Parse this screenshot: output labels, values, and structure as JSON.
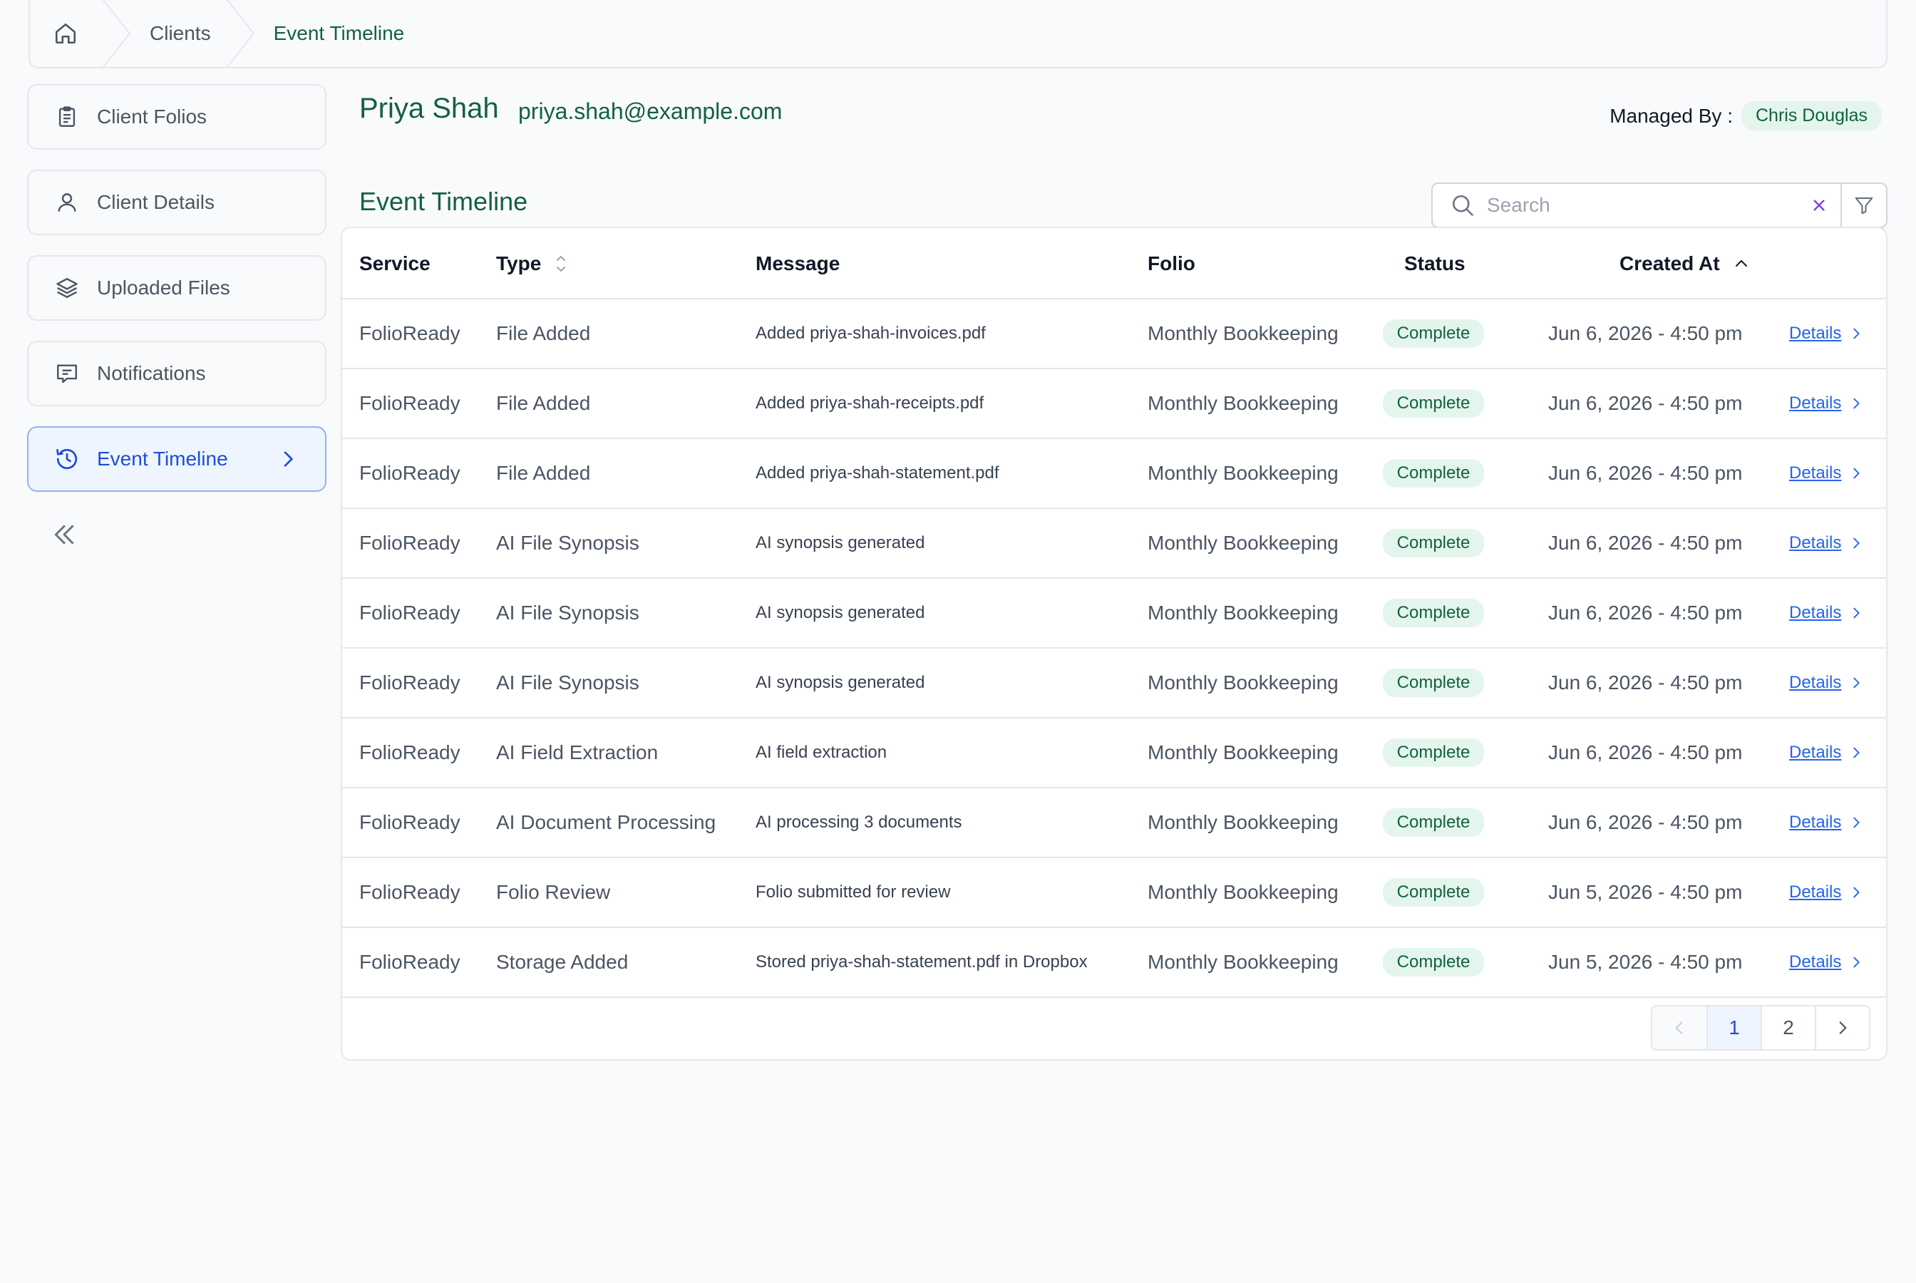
{
  "breadcrumb": {
    "items": [
      "Clients",
      "Event Timeline"
    ]
  },
  "sidebar": {
    "items": [
      {
        "label": "Client Folios"
      },
      {
        "label": "Client Details"
      },
      {
        "label": "Uploaded Files"
      },
      {
        "label": "Notifications"
      },
      {
        "label": "Event Timeline"
      }
    ]
  },
  "client": {
    "name": "Priya Shah",
    "email": "priya.shah@example.com",
    "managed_by_label": "Managed By :",
    "managed_by": "Chris Douglas"
  },
  "section_title": "Event Timeline",
  "search": {
    "placeholder": "Search",
    "value": ""
  },
  "table": {
    "columns": [
      "Service",
      "Type",
      "Message",
      "Folio",
      "Status",
      "Created At"
    ],
    "rows": [
      {
        "service": "FolioReady",
        "type": "File Added",
        "message": "Added priya-shah-invoices.pdf",
        "folio": "Monthly Bookkeeping",
        "status": "Complete",
        "created": "Jun 6, 2026 - 4:50 pm",
        "action": "Details"
      },
      {
        "service": "FolioReady",
        "type": "File Added",
        "message": "Added priya-shah-receipts.pdf",
        "folio": "Monthly Bookkeeping",
        "status": "Complete",
        "created": "Jun 6, 2026 - 4:50 pm",
        "action": "Details"
      },
      {
        "service": "FolioReady",
        "type": "File Added",
        "message": "Added priya-shah-statement.pdf",
        "folio": "Monthly Bookkeeping",
        "status": "Complete",
        "created": "Jun 6, 2026 - 4:50 pm",
        "action": "Details"
      },
      {
        "service": "FolioReady",
        "type": "AI File Synopsis",
        "message": "AI synopsis generated",
        "folio": "Monthly Bookkeeping",
        "status": "Complete",
        "created": "Jun 6, 2026 - 4:50 pm",
        "action": "Details"
      },
      {
        "service": "FolioReady",
        "type": "AI File Synopsis",
        "message": "AI synopsis generated",
        "folio": "Monthly Bookkeeping",
        "status": "Complete",
        "created": "Jun 6, 2026 - 4:50 pm",
        "action": "Details"
      },
      {
        "service": "FolioReady",
        "type": "AI File Synopsis",
        "message": "AI synopsis generated",
        "folio": "Monthly Bookkeeping",
        "status": "Complete",
        "created": "Jun 6, 2026 - 4:50 pm",
        "action": "Details"
      },
      {
        "service": "FolioReady",
        "type": "AI Field Extraction",
        "message": "AI field extraction",
        "folio": "Monthly Bookkeeping",
        "status": "Complete",
        "created": "Jun 6, 2026 - 4:50 pm",
        "action": "Details"
      },
      {
        "service": "FolioReady",
        "type": "AI Document Processing",
        "message": "AI processing 3 documents",
        "folio": "Monthly Bookkeeping",
        "status": "Complete",
        "created": "Jun 6, 2026 - 4:50 pm",
        "action": "Details"
      },
      {
        "service": "FolioReady",
        "type": "Folio Review",
        "message": "Folio submitted for review",
        "folio": "Monthly Bookkeeping",
        "status": "Complete",
        "created": "Jun 5, 2026 - 4:50 pm",
        "action": "Details"
      },
      {
        "service": "FolioReady",
        "type": "Storage Added",
        "message": "Stored priya-shah-statement.pdf in Dropbox",
        "folio": "Monthly Bookkeeping",
        "status": "Complete",
        "created": "Jun 5, 2026 - 4:50 pm",
        "action": "Details"
      }
    ]
  },
  "pagination": {
    "pages": [
      "1",
      "2"
    ],
    "current": "1"
  },
  "colors": {
    "brand_green": "#136140",
    "badge_bg": "#e3f5ec",
    "link_blue": "#2563eb",
    "active_bg": "#eff5ff"
  },
  "icons": [
    "home-icon",
    "clipboard-icon",
    "user-icon",
    "layers-icon",
    "message-square-icon",
    "history-icon",
    "chevron-right-icon",
    "chevrons-left-icon",
    "search-icon",
    "close-icon",
    "filter-icon",
    "sort-icon",
    "chevron-up-icon",
    "chevron-left-icon"
  ]
}
